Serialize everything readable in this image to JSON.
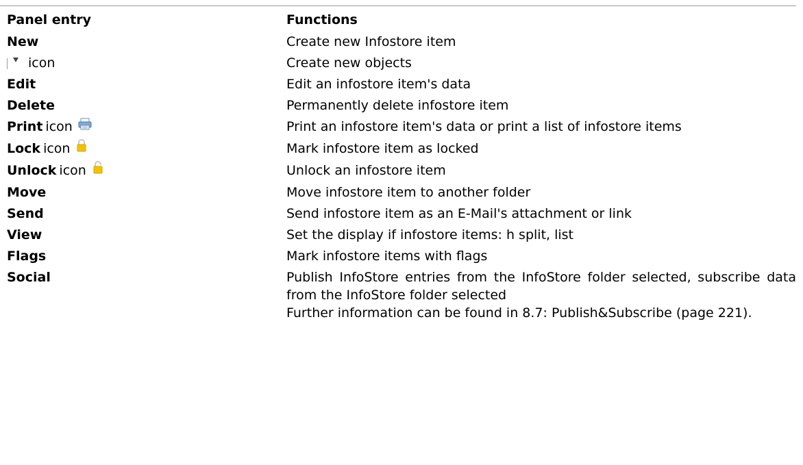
{
  "table": {
    "headers": {
      "entry": "Panel entry",
      "functions": "Functions"
    },
    "rows": [
      {
        "label": "New",
        "function": "Create new Infostore item"
      },
      {
        "label": "icon",
        "icon": "dropdown-triangle-icon",
        "function": "Create new objects"
      },
      {
        "label": "Edit",
        "function": "Edit an infostore item's data"
      },
      {
        "label": "Delete",
        "function": "Permanently delete infostore item"
      },
      {
        "label": "Print",
        "icon_word": "icon",
        "icon": "printer-icon",
        "function": "Print an infostore item's data or print a list of infostore items"
      },
      {
        "label": "Lock",
        "icon_word": "icon",
        "icon": "padlock-closed-icon",
        "function": "Mark infostore item as locked"
      },
      {
        "label": "Unlock",
        "icon_word": "icon",
        "icon": "padlock-open-icon",
        "function": "Unlock an infostore item"
      },
      {
        "label": "Move",
        "function": "Move infostore item to another folder"
      },
      {
        "label": "Send",
        "function": "Send infostore item as an E-Mail's attachment or link"
      },
      {
        "label": "View",
        "function": "Set the display if infostore items: h split, list"
      },
      {
        "label": "Flags",
        "function": "Mark infostore items with flags"
      },
      {
        "label": "Social",
        "function": "Publish InfoStore entries from the InfoStore folder selected, subscribe data from the InfoStore folder selected",
        "function_extra": "Further information can be found in 8.7: Publish&Subscribe (page 221)."
      }
    ]
  },
  "colors": {
    "icon_yellow": "#f2c200",
    "icon_blue": "#5b9bd5",
    "rule": "#9a9a9a"
  }
}
